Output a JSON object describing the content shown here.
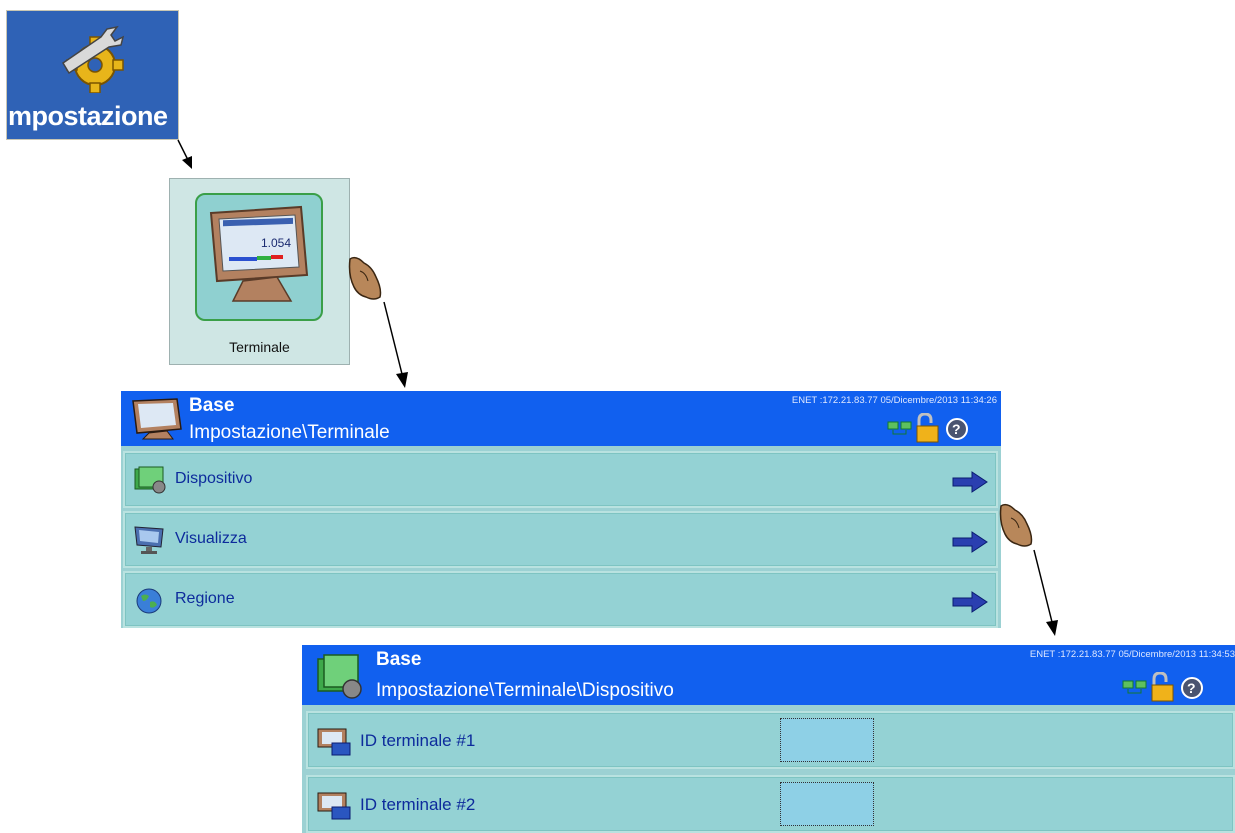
{
  "settings_tile": {
    "label": "Impostazione",
    "icon": "gear-wrench-icon"
  },
  "terminal_tile": {
    "label": "Terminale",
    "icon": "terminal-icon",
    "screen_value": "1.054"
  },
  "screen1": {
    "title": "Base",
    "path": "Impostazione\\Terminale",
    "status": "ENET :172.21.83.77  05/Dicembre/2013 11:34:26",
    "items": [
      {
        "label": "Dispositivo",
        "icon": "device-icon"
      },
      {
        "label": "Visualizza",
        "icon": "display-icon"
      },
      {
        "label": "Regione",
        "icon": "globe-icon"
      }
    ]
  },
  "screen2": {
    "title": "Base",
    "path": "Impostazione\\Terminale\\Dispositivo",
    "status": "ENET :172.21.83.77  05/Dicembre/2013 11:34:53",
    "items": [
      {
        "label": "ID terminale #1",
        "value": ""
      },
      {
        "label": "ID terminale #2",
        "value": ""
      }
    ]
  },
  "colors": {
    "header_blue": "#1160ef",
    "row_teal": "#94d2d4",
    "tile_blue": "#2f62b6",
    "arrow_blue": "#2a3fb0"
  }
}
